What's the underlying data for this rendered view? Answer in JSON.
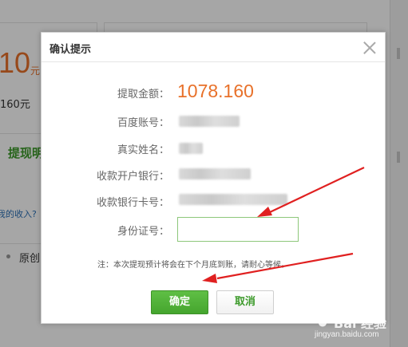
{
  "background": {
    "amount": "10",
    "unit": "元",
    "sub_amount": "160元",
    "withdraw_label": "提现明",
    "my_income_link": "我的收入?",
    "original_label": "原创"
  },
  "dialog": {
    "title": "确认提示",
    "rows": [
      {
        "label": "提取金额：",
        "value": "1078.160"
      },
      {
        "label": "百度账号："
      },
      {
        "label": "真实姓名："
      },
      {
        "label": "收款开户银行："
      },
      {
        "label": "收款银行卡号："
      },
      {
        "label": "身份证号："
      }
    ],
    "id_input_value": "",
    "note": "注：本次提现预计将会在下个月底到账，请耐心等候。",
    "confirm_label": "确定",
    "cancel_label": "取消"
  },
  "watermark": {
    "main": "Bai 经验",
    "sub": "jingyan.baidu.com"
  },
  "colors": {
    "amount": "#e8712a",
    "confirm_button": "#4cae35",
    "cancel_text": "#3c9a2a",
    "input_border": "#8dc77a",
    "arrow": "#e02020"
  },
  "icons": [
    "close-icon",
    "paw-icon"
  ]
}
